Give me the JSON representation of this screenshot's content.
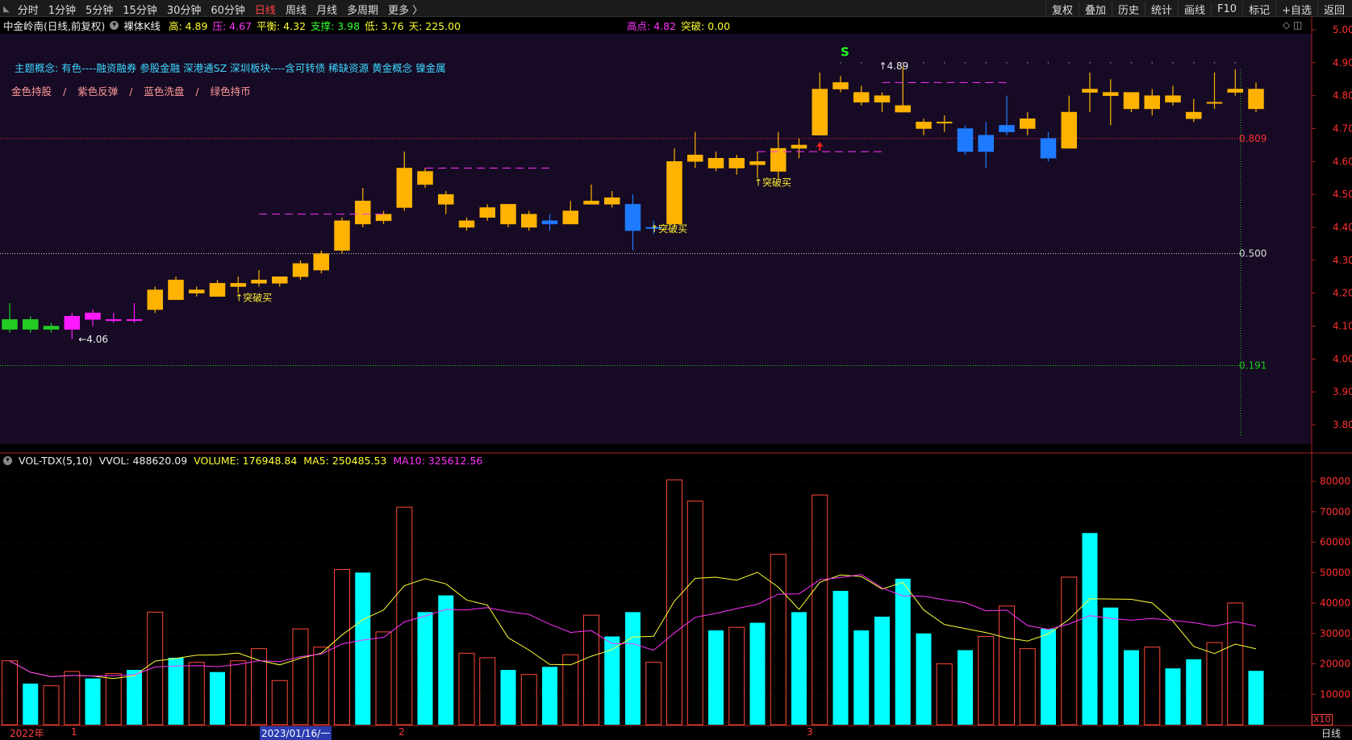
{
  "topbar": {
    "periods": [
      "分时",
      "1分钟",
      "5分钟",
      "15分钟",
      "30分钟",
      "60分钟",
      "日线",
      "周线",
      "月线",
      "多周期",
      "更多 〉"
    ],
    "active_period": "日线",
    "right_buttons": [
      "复权",
      "叠加",
      "历史",
      "统计",
      "画线",
      "F10",
      "标记",
      "+自选",
      "返回"
    ]
  },
  "info": {
    "stock": "中金岭南(日线,前复权)",
    "mode": "裸体K线",
    "high": "高: 4.89",
    "press": "压: 4.67",
    "balance": "平衡: 4.32",
    "support": "支撑: 3.98",
    "low": "低: 3.76",
    "days": "天: 225.00",
    "peak": "高点: 4.82",
    "breakout": "突破: 0.00"
  },
  "theme_text": "主题概念:        有色----融资融券 参股金融 深港通SZ 深圳板块----含可转债 稀缺资源 黄金概念 镍金属",
  "legend": [
    "金色持股",
    "/",
    "紫色反弹",
    "/",
    "蓝色洗盘",
    "/",
    "绿色持币"
  ],
  "volume_info": {
    "name": "VOL-TDX(5,10)",
    "vvol": "VVOL: 488620.09",
    "volume": "VOLUME: 176948.84",
    "ma5": "MA5: 250485.53",
    "ma10": "MA10: 325612.56"
  },
  "bottom": {
    "labels": [
      "2022年",
      "1",
      "2023/01/16/一",
      "2",
      "3"
    ],
    "period_label": "日线",
    "x10": "X10"
  },
  "colors": {
    "gold": "#ffb300",
    "purple": "#ff1aff",
    "blue": "#1e7bff",
    "green": "#22cc22",
    "vol_up": "#ff4a3a",
    "vol_down": "#00ffff",
    "ma5": "#ffff33",
    "ma10": "#ff33ff",
    "price_bg": "#170a24"
  },
  "chart_data": {
    "type": "candlestick",
    "y_ticks": [
      "5.00",
      "4.90",
      "4.80",
      "4.70",
      "4.60",
      "4.50",
      "4.40",
      "4.30",
      "4.20",
      "4.10",
      "4.00",
      "3.90",
      "3.80"
    ],
    "ylim": [
      3.76,
      5.03
    ],
    "levels": [
      {
        "label": "0.809",
        "price": 4.67,
        "color": "#ff3030"
      },
      {
        "label": "0.500",
        "price": 4.32,
        "color": "#dddddd"
      },
      {
        "label": "0.191",
        "price": 3.98,
        "color": "#22cc22"
      }
    ],
    "annotations": [
      {
        "text": "←4.06",
        "index": 3,
        "price": 4.06
      },
      {
        "text": "↑突破买",
        "index": 11,
        "price": 4.21
      },
      {
        "text": "↑突破买",
        "index": 31,
        "price": 4.42
      },
      {
        "text": "↑突破买",
        "index": 36,
        "price": 4.56
      },
      {
        "text": "↑4.89",
        "index": 42,
        "price": 4.89
      },
      {
        "text": "S",
        "index": 40,
        "price": 4.92
      }
    ],
    "candles": [
      {
        "o": 4.09,
        "h": 4.17,
        "l": 4.08,
        "c": 4.12,
        "t": "g"
      },
      {
        "o": 4.09,
        "h": 4.13,
        "l": 4.08,
        "c": 4.12,
        "t": "g"
      },
      {
        "o": 4.1,
        "h": 4.11,
        "l": 4.08,
        "c": 4.09,
        "t": "g"
      },
      {
        "o": 4.09,
        "h": 4.14,
        "l": 4.06,
        "c": 4.13,
        "t": "p"
      },
      {
        "o": 4.12,
        "h": 4.15,
        "l": 4.1,
        "c": 4.14,
        "t": "p"
      },
      {
        "o": 4.12,
        "h": 4.14,
        "l": 4.11,
        "c": 4.12,
        "t": "p"
      },
      {
        "o": 4.12,
        "h": 4.17,
        "l": 4.11,
        "c": 4.12,
        "t": "p"
      },
      {
        "o": 4.15,
        "h": 4.22,
        "l": 4.14,
        "c": 4.21,
        "t": "y"
      },
      {
        "o": 4.18,
        "h": 4.25,
        "l": 4.18,
        "c": 4.24,
        "t": "y"
      },
      {
        "o": 4.2,
        "h": 4.22,
        "l": 4.19,
        "c": 4.21,
        "t": "y"
      },
      {
        "o": 4.19,
        "h": 4.24,
        "l": 4.19,
        "c": 4.23,
        "t": "y"
      },
      {
        "o": 4.22,
        "h": 4.25,
        "l": 4.2,
        "c": 4.23,
        "t": "y"
      },
      {
        "o": 4.23,
        "h": 4.27,
        "l": 4.22,
        "c": 4.24,
        "t": "y"
      },
      {
        "o": 4.23,
        "h": 4.25,
        "l": 4.22,
        "c": 4.25,
        "t": "y"
      },
      {
        "o": 4.25,
        "h": 4.3,
        "l": 4.24,
        "c": 4.29,
        "t": "y"
      },
      {
        "o": 4.27,
        "h": 4.33,
        "l": 4.26,
        "c": 4.32,
        "t": "y"
      },
      {
        "o": 4.33,
        "h": 4.43,
        "l": 4.32,
        "c": 4.42,
        "t": "y"
      },
      {
        "o": 4.41,
        "h": 4.52,
        "l": 4.4,
        "c": 4.48,
        "t": "y"
      },
      {
        "o": 4.42,
        "h": 4.45,
        "l": 4.41,
        "c": 4.44,
        "t": "y"
      },
      {
        "o": 4.46,
        "h": 4.63,
        "l": 4.45,
        "c": 4.58,
        "t": "y"
      },
      {
        "o": 4.53,
        "h": 4.58,
        "l": 4.52,
        "c": 4.57,
        "t": "y"
      },
      {
        "o": 4.47,
        "h": 4.51,
        "l": 4.44,
        "c": 4.5,
        "t": "y"
      },
      {
        "o": 4.4,
        "h": 4.43,
        "l": 4.39,
        "c": 4.42,
        "t": "y"
      },
      {
        "o": 4.43,
        "h": 4.47,
        "l": 4.42,
        "c": 4.46,
        "t": "y"
      },
      {
        "o": 4.41,
        "h": 4.47,
        "l": 4.4,
        "c": 4.47,
        "t": "y"
      },
      {
        "o": 4.4,
        "h": 4.45,
        "l": 4.39,
        "c": 4.44,
        "t": "y"
      },
      {
        "o": 4.42,
        "h": 4.44,
        "l": 4.39,
        "c": 4.41,
        "t": "b"
      },
      {
        "o": 4.41,
        "h": 4.48,
        "l": 4.41,
        "c": 4.45,
        "t": "y"
      },
      {
        "o": 4.47,
        "h": 4.53,
        "l": 4.47,
        "c": 4.48,
        "t": "y"
      },
      {
        "o": 4.47,
        "h": 4.51,
        "l": 4.46,
        "c": 4.49,
        "t": "y"
      },
      {
        "o": 4.47,
        "h": 4.5,
        "l": 4.33,
        "c": 4.39,
        "t": "b"
      },
      {
        "o": 4.4,
        "h": 4.42,
        "l": 4.38,
        "c": 4.4,
        "t": "b"
      },
      {
        "o": 4.41,
        "h": 4.64,
        "l": 4.4,
        "c": 4.6,
        "t": "y"
      },
      {
        "o": 4.6,
        "h": 4.69,
        "l": 4.58,
        "c": 4.62,
        "t": "y"
      },
      {
        "o": 4.58,
        "h": 4.63,
        "l": 4.57,
        "c": 4.61,
        "t": "y"
      },
      {
        "o": 4.58,
        "h": 4.62,
        "l": 4.56,
        "c": 4.61,
        "t": "y"
      },
      {
        "o": 4.59,
        "h": 4.63,
        "l": 4.55,
        "c": 4.6,
        "t": "y"
      },
      {
        "o": 4.57,
        "h": 4.69,
        "l": 4.55,
        "c": 4.64,
        "t": "y"
      },
      {
        "o": 4.64,
        "h": 4.67,
        "l": 4.61,
        "c": 4.65,
        "t": "y"
      },
      {
        "o": 4.68,
        "h": 4.87,
        "l": 4.68,
        "c": 4.82,
        "t": "y"
      },
      {
        "o": 4.82,
        "h": 4.86,
        "l": 4.81,
        "c": 4.84,
        "t": "y"
      },
      {
        "o": 4.78,
        "h": 4.83,
        "l": 4.77,
        "c": 4.81,
        "t": "y"
      },
      {
        "o": 4.78,
        "h": 4.81,
        "l": 4.75,
        "c": 4.8,
        "t": "y"
      },
      {
        "o": 4.75,
        "h": 4.89,
        "l": 4.75,
        "c": 4.77,
        "t": "y"
      },
      {
        "o": 4.7,
        "h": 4.73,
        "l": 4.68,
        "c": 4.72,
        "t": "y"
      },
      {
        "o": 4.72,
        "h": 4.74,
        "l": 4.69,
        "c": 4.72,
        "t": "y"
      },
      {
        "o": 4.7,
        "h": 4.71,
        "l": 4.62,
        "c": 4.63,
        "t": "b"
      },
      {
        "o": 4.68,
        "h": 4.72,
        "l": 4.58,
        "c": 4.63,
        "t": "b"
      },
      {
        "o": 4.71,
        "h": 4.8,
        "l": 4.68,
        "c": 4.69,
        "t": "b"
      },
      {
        "o": 4.7,
        "h": 4.75,
        "l": 4.68,
        "c": 4.73,
        "t": "y"
      },
      {
        "o": 4.67,
        "h": 4.69,
        "l": 4.6,
        "c": 4.61,
        "t": "b"
      },
      {
        "o": 4.64,
        "h": 4.8,
        "l": 4.64,
        "c": 4.75,
        "t": "y"
      },
      {
        "o": 4.81,
        "h": 4.87,
        "l": 4.75,
        "c": 4.82,
        "t": "y"
      },
      {
        "o": 4.8,
        "h": 4.85,
        "l": 4.71,
        "c": 4.81,
        "t": "y"
      },
      {
        "o": 4.76,
        "h": 4.81,
        "l": 4.75,
        "c": 4.81,
        "t": "y"
      },
      {
        "o": 4.76,
        "h": 4.82,
        "l": 4.74,
        "c": 4.8,
        "t": "y"
      },
      {
        "o": 4.78,
        "h": 4.83,
        "l": 4.77,
        "c": 4.8,
        "t": "y"
      },
      {
        "o": 4.73,
        "h": 4.79,
        "l": 4.72,
        "c": 4.75,
        "t": "y"
      },
      {
        "o": 4.78,
        "h": 4.87,
        "l": 4.76,
        "c": 4.78,
        "t": "y"
      },
      {
        "o": 4.81,
        "h": 4.88,
        "l": 4.8,
        "c": 4.82,
        "t": "y"
      },
      {
        "o": 4.76,
        "h": 4.84,
        "l": 4.75,
        "c": 4.82,
        "t": "y"
      }
    ],
    "volume": {
      "y_ticks": [
        "80000",
        "70000",
        "60000",
        "50000",
        "40000",
        "30000",
        "20000",
        "10000"
      ],
      "ylim": [
        0,
        84000
      ],
      "bars": [
        {
          "v": 21000,
          "t": "u"
        },
        {
          "v": 13500,
          "t": "d"
        },
        {
          "v": 12800,
          "t": "u"
        },
        {
          "v": 17500,
          "t": "u"
        },
        {
          "v": 15200,
          "t": "d"
        },
        {
          "v": 16800,
          "t": "u"
        },
        {
          "v": 18000,
          "t": "d"
        },
        {
          "v": 37000,
          "t": "u"
        },
        {
          "v": 22000,
          "t": "d"
        },
        {
          "v": 20500,
          "t": "u"
        },
        {
          "v": 17300,
          "t": "d"
        },
        {
          "v": 21000,
          "t": "u"
        },
        {
          "v": 25000,
          "t": "u"
        },
        {
          "v": 14500,
          "t": "u"
        },
        {
          "v": 31500,
          "t": "u"
        },
        {
          "v": 25500,
          "t": "u"
        },
        {
          "v": 51000,
          "t": "u"
        },
        {
          "v": 50000,
          "t": "d"
        },
        {
          "v": 30500,
          "t": "u"
        },
        {
          "v": 71500,
          "t": "u"
        },
        {
          "v": 37000,
          "t": "d"
        },
        {
          "v": 42500,
          "t": "d"
        },
        {
          "v": 23500,
          "t": "u"
        },
        {
          "v": 22000,
          "t": "u"
        },
        {
          "v": 18000,
          "t": "d"
        },
        {
          "v": 16500,
          "t": "u"
        },
        {
          "v": 19000,
          "t": "d"
        },
        {
          "v": 23000,
          "t": "u"
        },
        {
          "v": 36000,
          "t": "u"
        },
        {
          "v": 29000,
          "t": "d"
        },
        {
          "v": 37000,
          "t": "d"
        },
        {
          "v": 20500,
          "t": "u"
        },
        {
          "v": 80500,
          "t": "u"
        },
        {
          "v": 73500,
          "t": "u"
        },
        {
          "v": 31000,
          "t": "d"
        },
        {
          "v": 32000,
          "t": "u"
        },
        {
          "v": 33500,
          "t": "d"
        },
        {
          "v": 56000,
          "t": "u"
        },
        {
          "v": 37000,
          "t": "d"
        },
        {
          "v": 75500,
          "t": "u"
        },
        {
          "v": 44000,
          "t": "d"
        },
        {
          "v": 31000,
          "t": "d"
        },
        {
          "v": 35500,
          "t": "d"
        },
        {
          "v": 48000,
          "t": "d"
        },
        {
          "v": 30000,
          "t": "d"
        },
        {
          "v": 20000,
          "t": "u"
        },
        {
          "v": 24500,
          "t": "d"
        },
        {
          "v": 29000,
          "t": "u"
        },
        {
          "v": 39000,
          "t": "u"
        },
        {
          "v": 25000,
          "t": "u"
        },
        {
          "v": 31500,
          "t": "d"
        },
        {
          "v": 48500,
          "t": "u"
        },
        {
          "v": 63000,
          "t": "d"
        },
        {
          "v": 38500,
          "t": "d"
        },
        {
          "v": 24500,
          "t": "d"
        },
        {
          "v": 25500,
          "t": "u"
        },
        {
          "v": 18500,
          "t": "d"
        },
        {
          "v": 21500,
          "t": "d"
        },
        {
          "v": 27000,
          "t": "u"
        },
        {
          "v": 40000,
          "t": "u"
        },
        {
          "v": 17700,
          "t": "d"
        }
      ]
    }
  }
}
